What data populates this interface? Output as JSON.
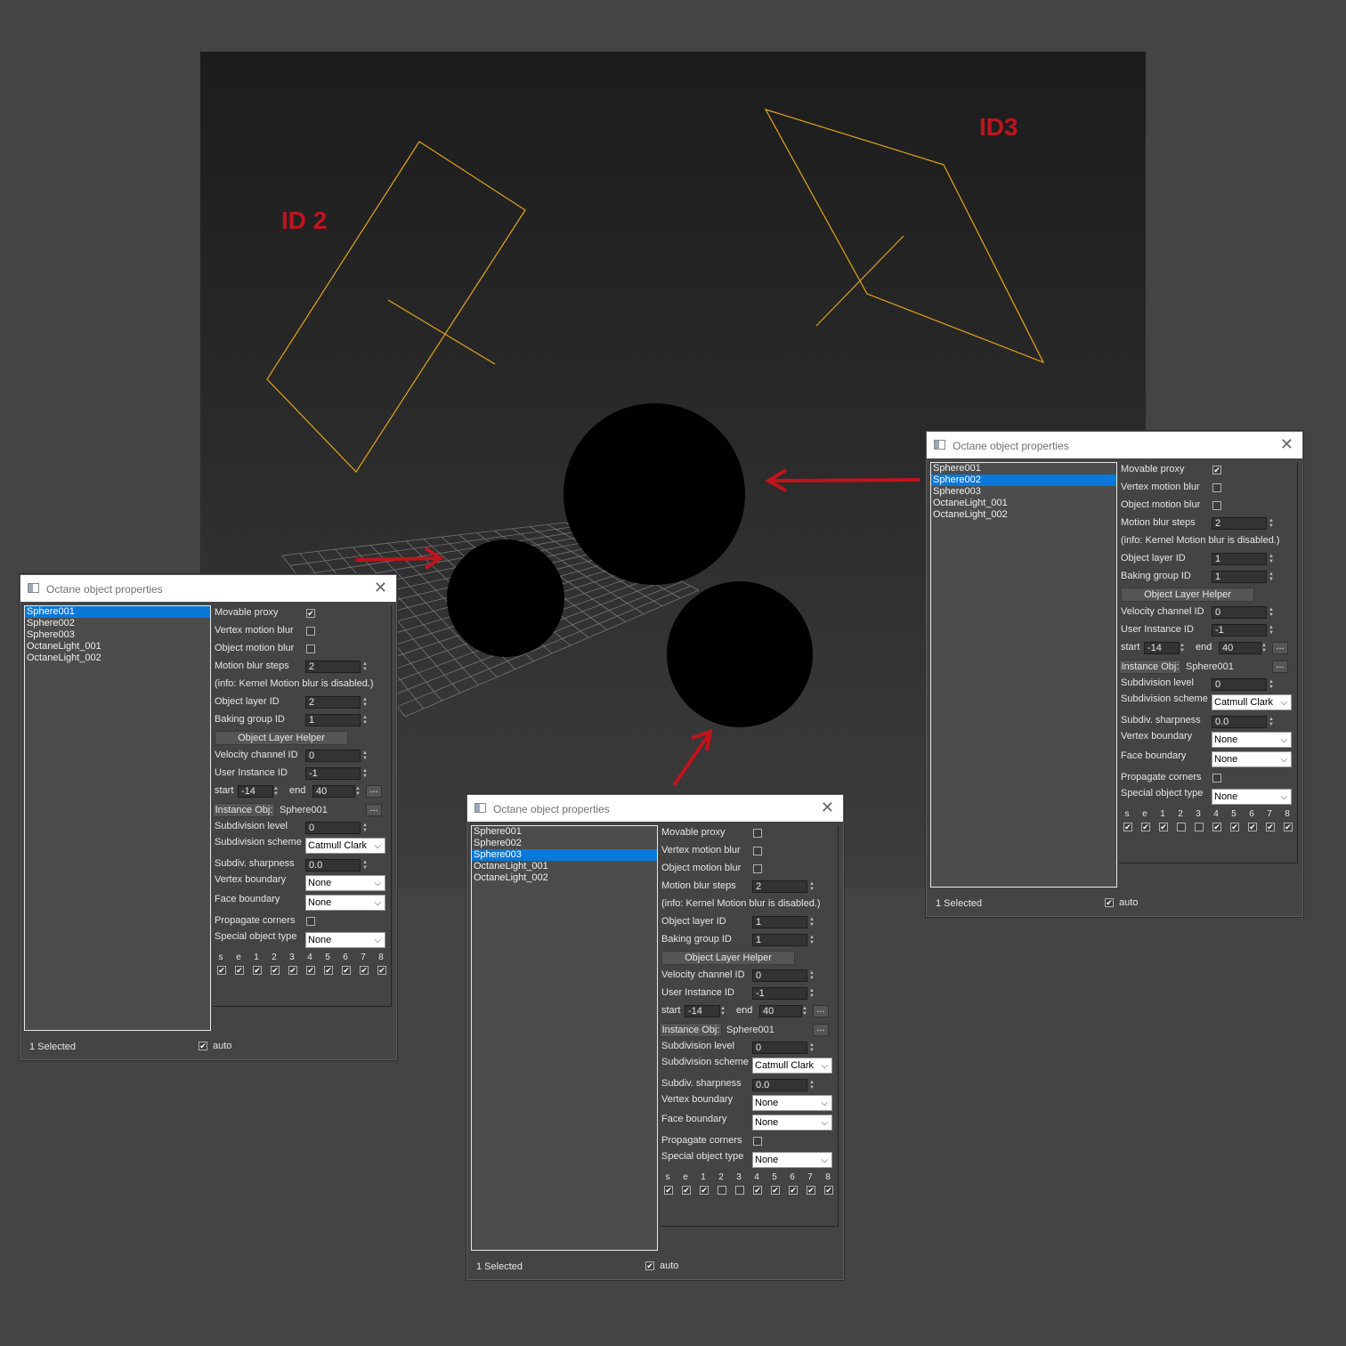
{
  "viewport": {
    "label_id2": "ID 2",
    "label_id3": "ID3",
    "accent_label_color": "#c0131c",
    "light_wire_color": "#e3a41a",
    "arrow_color": "#c0131c"
  },
  "panels": [
    {
      "title": "Octane object properties",
      "objects": [
        "Sphere001",
        "Sphere002",
        "Sphere003",
        "OctaneLight_001",
        "OctaneLight_002"
      ],
      "selected_index": 0,
      "movable_proxy_label": "Movable proxy",
      "movable_proxy": true,
      "vertex_motion_blur_label": "Vertex motion blur",
      "vertex_motion_blur": false,
      "object_motion_blur_label": "Object motion blur",
      "object_motion_blur": false,
      "motion_blur_steps_label": "Motion blur steps",
      "motion_blur_steps": "2",
      "info_text": "(info: Kernel Motion blur is disabled.)",
      "object_layer_id_label": "Object layer ID",
      "object_layer_id": "2",
      "baking_group_id_label": "Baking group ID",
      "baking_group_id": "1",
      "object_layer_helper_label": "Object Layer Helper",
      "velocity_channel_id_label": "Velocity channel ID",
      "velocity_channel_id": "0",
      "user_instance_id_label": "User Instance ID",
      "user_instance_id": "-1",
      "start_label": "start",
      "start": "-14",
      "end_label": "end",
      "end": "40",
      "dots_label": "...",
      "instance_obj_label": "Instance Obj:",
      "instance_obj": "Sphere001",
      "subdivision_level_label": "Subdivision level",
      "subdivision_level": "0",
      "subdivision_scheme_label": "Subdivision scheme",
      "subdivision_scheme": "Catmull Clark",
      "subdiv_sharpness_label": "Subdiv. sharpness",
      "subdiv_sharpness": "0.0",
      "vertex_boundary_label": "Vertex boundary",
      "vertex_boundary": "None",
      "face_boundary_label": "Face boundary",
      "face_boundary": "None",
      "propagate_corners_label": "Propagate corners",
      "propagate_corners": false,
      "special_object_type_label": "Special object type",
      "special_object_type": "None",
      "flag_labels": [
        "s",
        "e",
        "1",
        "2",
        "3",
        "4",
        "5",
        "6",
        "7",
        "8"
      ],
      "flag_values": [
        true,
        true,
        true,
        true,
        true,
        true,
        true,
        true,
        true,
        true
      ],
      "status": "1 Selected",
      "auto_label": "auto",
      "auto": true
    },
    {
      "title": "Octane object properties",
      "objects": [
        "Sphere001",
        "Sphere002",
        "Sphere003",
        "OctaneLight_001",
        "OctaneLight_002"
      ],
      "selected_index": 2,
      "movable_proxy_label": "Movable proxy",
      "movable_proxy": false,
      "vertex_motion_blur_label": "Vertex motion blur",
      "vertex_motion_blur": false,
      "object_motion_blur_label": "Object motion blur",
      "object_motion_blur": false,
      "motion_blur_steps_label": "Motion blur steps",
      "motion_blur_steps": "2",
      "info_text": "(info: Kernel Motion blur is disabled.)",
      "object_layer_id_label": "Object layer ID",
      "object_layer_id": "1",
      "baking_group_id_label": "Baking group ID",
      "baking_group_id": "1",
      "object_layer_helper_label": "Object Layer Helper",
      "velocity_channel_id_label": "Velocity channel ID",
      "velocity_channel_id": "0",
      "user_instance_id_label": "User Instance ID",
      "user_instance_id": "-1",
      "start_label": "start",
      "start": "-14",
      "end_label": "end",
      "end": "40",
      "dots_label": "...",
      "instance_obj_label": "Instance Obj:",
      "instance_obj": "Sphere001",
      "subdivision_level_label": "Subdivision level",
      "subdivision_level": "0",
      "subdivision_scheme_label": "Subdivision scheme",
      "subdivision_scheme": "Catmull Clark",
      "subdiv_sharpness_label": "Subdiv. sharpness",
      "subdiv_sharpness": "0.0",
      "vertex_boundary_label": "Vertex boundary",
      "vertex_boundary": "None",
      "face_boundary_label": "Face boundary",
      "face_boundary": "None",
      "propagate_corners_label": "Propagate corners",
      "propagate_corners": false,
      "special_object_type_label": "Special object type",
      "special_object_type": "None",
      "flag_labels": [
        "s",
        "e",
        "1",
        "2",
        "3",
        "4",
        "5",
        "6",
        "7",
        "8"
      ],
      "flag_values": [
        true,
        true,
        true,
        false,
        false,
        true,
        true,
        true,
        true,
        true
      ],
      "status": "1 Selected",
      "auto_label": "auto",
      "auto": true
    },
    {
      "title": "Octane object properties",
      "objects": [
        "Sphere001",
        "Sphere002",
        "Sphere003",
        "OctaneLight_001",
        "OctaneLight_002"
      ],
      "selected_index": 1,
      "movable_proxy_label": "Movable proxy",
      "movable_proxy": true,
      "vertex_motion_blur_label": "Vertex motion blur",
      "vertex_motion_blur": false,
      "object_motion_blur_label": "Object motion blur",
      "object_motion_blur": false,
      "motion_blur_steps_label": "Motion blur steps",
      "motion_blur_steps": "2",
      "info_text": "(info: Kernel Motion blur is disabled.)",
      "object_layer_id_label": "Object layer ID",
      "object_layer_id": "1",
      "baking_group_id_label": "Baking group ID",
      "baking_group_id": "1",
      "object_layer_helper_label": "Object Layer Helper",
      "velocity_channel_id_label": "Velocity channel ID",
      "velocity_channel_id": "0",
      "user_instance_id_label": "User Instance ID",
      "user_instance_id": "-1",
      "start_label": "start",
      "start": "-14",
      "end_label": "end",
      "end": "40",
      "dots_label": "...",
      "instance_obj_label": "Instance Obj:",
      "instance_obj": "Sphere001",
      "subdivision_level_label": "Subdivision level",
      "subdivision_level": "0",
      "subdivision_scheme_label": "Subdivision scheme",
      "subdivision_scheme": "Catmull Clark",
      "subdiv_sharpness_label": "Subdiv. sharpness",
      "subdiv_sharpness": "0.0",
      "vertex_boundary_label": "Vertex boundary",
      "vertex_boundary": "None",
      "face_boundary_label": "Face boundary",
      "face_boundary": "None",
      "propagate_corners_label": "Propagate corners",
      "propagate_corners": false,
      "special_object_type_label": "Special object type",
      "special_object_type": "None",
      "flag_labels": [
        "s",
        "e",
        "1",
        "2",
        "3",
        "4",
        "5",
        "6",
        "7",
        "8"
      ],
      "flag_values": [
        true,
        true,
        true,
        false,
        false,
        true,
        true,
        true,
        true,
        true
      ],
      "status": "1 Selected",
      "auto_label": "auto",
      "auto": true
    }
  ]
}
